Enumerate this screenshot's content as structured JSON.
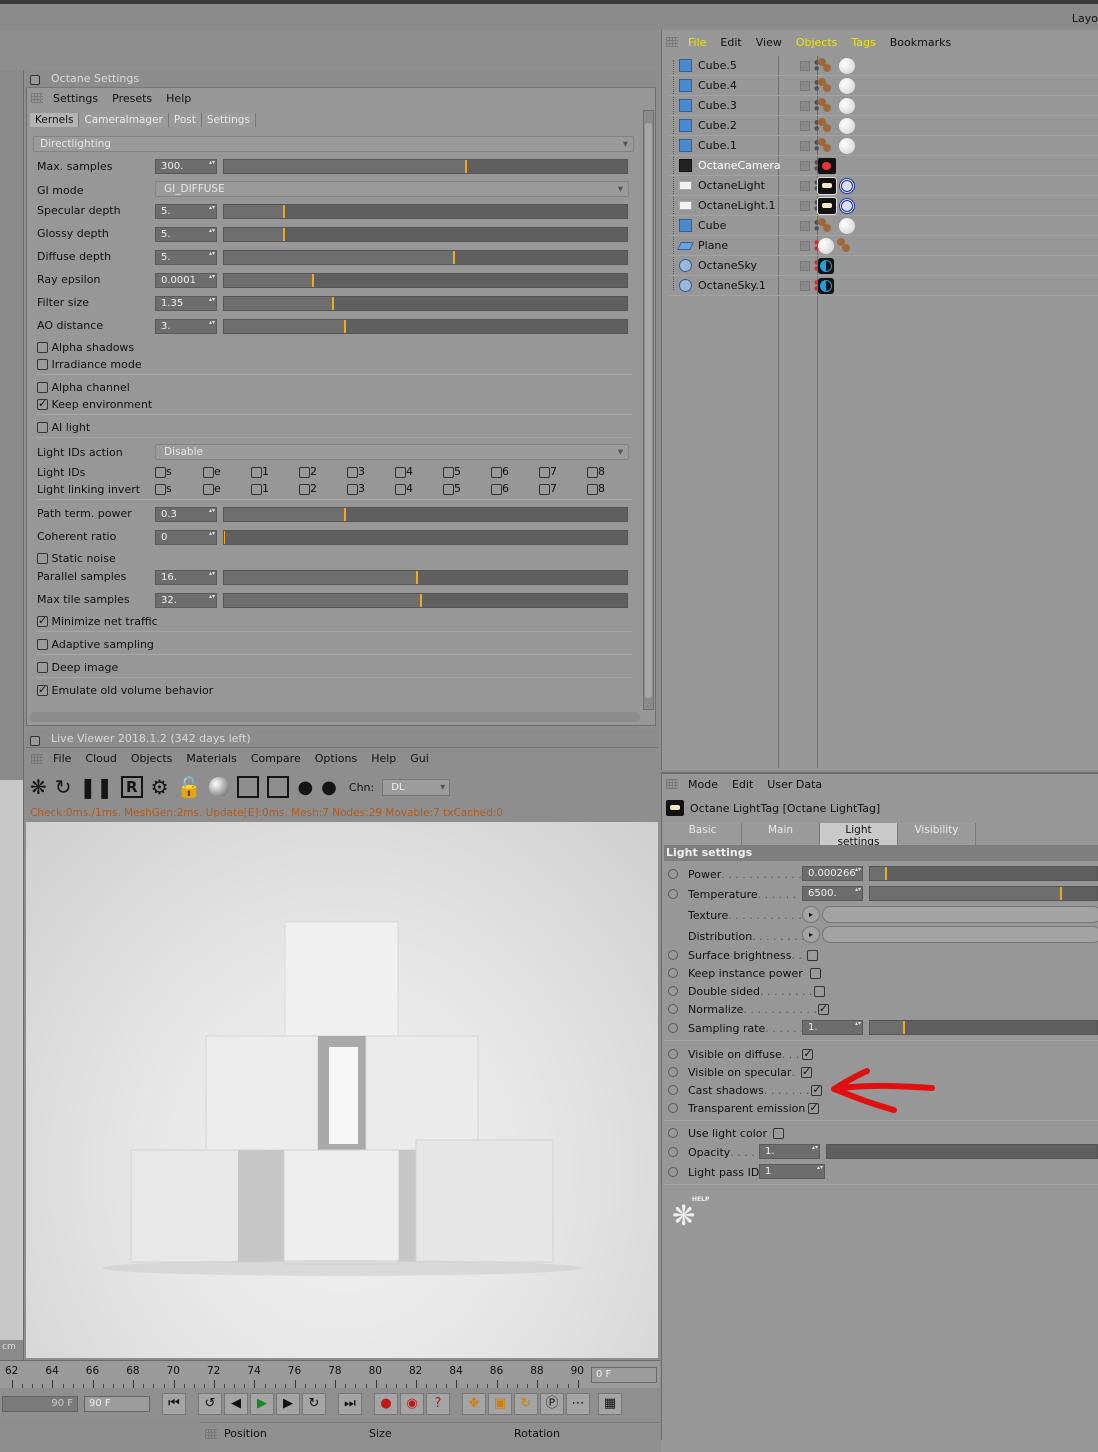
{
  "top_right_label": "Layo",
  "octane_settings": {
    "title": "Octane Settings",
    "menu": [
      "Settings",
      "Presets",
      "Help"
    ],
    "tabs": [
      "Kernels",
      "CameraImager",
      "Post",
      "Settings"
    ],
    "kernel": "Directlighting",
    "params": [
      {
        "label": "Max. samples",
        "value": "300.",
        "level": 0.6
      },
      {
        "label": "GI mode",
        "value": "GI_DIFFUSE"
      },
      {
        "label": "Specular depth",
        "value": "5.",
        "level": 0.15
      },
      {
        "label": "Glossy depth",
        "value": "5.",
        "level": 0.15
      },
      {
        "label": "Diffuse depth",
        "value": "5.",
        "level": 0.57
      },
      {
        "label": "Ray epsilon",
        "value": "0.0001",
        "level": 0.22
      },
      {
        "label": "Filter size",
        "value": "1.35",
        "level": 0.27
      },
      {
        "label": "AO distance",
        "value": "3.",
        "level": 0.3
      }
    ],
    "alpha_shadows": "Alpha shadows",
    "irradiance_mode": "Irradiance mode",
    "alpha_channel": "Alpha channel",
    "keep_environment": "Keep environment",
    "ai_light": "AI light",
    "light_ids_action_label": "Light IDs action",
    "light_ids_action_value": "Disable",
    "light_ids_label": "Light IDs",
    "light_linking_label": "Light linking invert",
    "light_id_options": [
      "s",
      "e",
      "1",
      "2",
      "3",
      "4",
      "5",
      "6",
      "7",
      "8"
    ],
    "path_term_power": {
      "label": "Path term. power",
      "value": "0.3",
      "level": 0.3
    },
    "coherent_ratio": {
      "label": "Coherent ratio",
      "value": "0",
      "level": 0.0
    },
    "static_noise": "Static noise",
    "parallel_samples": {
      "label": "Parallel samples",
      "value": "16.",
      "level": 0.48
    },
    "max_tile_samples": {
      "label": "Max tile samples",
      "value": "32.",
      "level": 0.49
    },
    "minimize_net_traffic": "Minimize net traffic",
    "adaptive_sampling": "Adaptive sampling",
    "deep_image": "Deep image",
    "emulate_old_volume": "Emulate old volume behavior"
  },
  "live_viewer": {
    "title": "Live Viewer 2018.1.2 (342 days left)",
    "menu": [
      "File",
      "Cloud",
      "Objects",
      "Materials",
      "Compare",
      "Options",
      "Help",
      "Gui"
    ],
    "chn_label": "Chn:",
    "chn_value": "DL",
    "status": "Check:0ms./1ms. MeshGen:2ms. Update[E]:0ms. Mesh:7 Nodes:29 Movable:7 txCached:0"
  },
  "object_manager": {
    "menu": [
      "File",
      "Edit",
      "View",
      "Objects",
      "Tags",
      "Bookmarks"
    ],
    "objects": [
      "Cube.5",
      "Cube.4",
      "Cube.3",
      "Cube.2",
      "Cube.1",
      "OctaneCamera",
      "OctaneLight",
      "OctaneLight.1",
      "Cube",
      "Plane",
      "OctaneSky",
      "OctaneSky.1"
    ]
  },
  "attribute_manager": {
    "menu": [
      "Mode",
      "Edit",
      "User Data"
    ],
    "title": "Octane LightTag [Octane LightTag]",
    "tabs": [
      "Basic",
      "Main",
      "Light settings",
      "Visibility"
    ],
    "section": "Light settings",
    "power": {
      "label": "Power",
      "value": "0.000266",
      "level": 0.07
    },
    "temperature": {
      "label": "Temperature",
      "value": "6500.",
      "level": 0.84
    },
    "texture": "Texture",
    "distribution": "Distribution",
    "surface_brightness": "Surface brightness",
    "keep_instance_power": "Keep instance power",
    "double_sided": "Double sided",
    "normalize": "Normalize",
    "sampling_rate": {
      "label": "Sampling rate",
      "value": "1.",
      "level": 0.15
    },
    "visible_on_diffuse": "Visible on diffuse",
    "visible_on_specular": "Visible on specular",
    "cast_shadows": "Cast shadows",
    "transparent_emission": "Transparent emission",
    "use_light_color": "Use light color",
    "opacity": {
      "label": "Opacity",
      "value": "1."
    },
    "light_pass_id": {
      "label": "Light pass ID",
      "value": "1"
    },
    "help_label": "HELP"
  },
  "timeline": {
    "ticks": [
      "62",
      "64",
      "66",
      "68",
      "70",
      "72",
      "74",
      "76",
      "78",
      "80",
      "82",
      "84",
      "86",
      "88",
      "90"
    ],
    "current_frame": "0 F",
    "start_field": "90 F",
    "end_field": "90 F",
    "cm_label": "cm"
  },
  "coord_bar": {
    "position": "Position",
    "size": "Size",
    "rotation": "Rotation"
  }
}
